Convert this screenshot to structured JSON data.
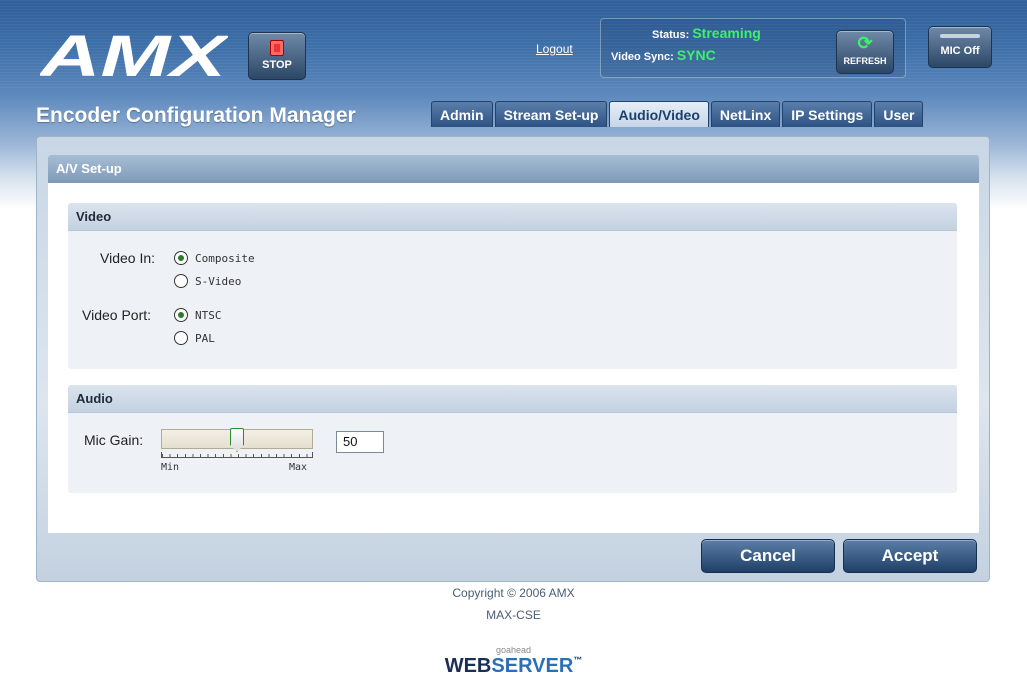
{
  "header": {
    "logo_text": "AMX",
    "stop_label": "STOP",
    "logout_label": "Logout",
    "status_label": "Status:",
    "status_value": "Streaming",
    "video_sync_label": "Video Sync:",
    "video_sync_value": "SYNC",
    "refresh_label": "REFRESH",
    "mic_label": "MIC Off",
    "app_title": "Encoder Configuration Manager"
  },
  "tabs": [
    {
      "label": "Admin"
    },
    {
      "label": "Stream Set-up"
    },
    {
      "label": "Audio/Video",
      "active": true
    },
    {
      "label": "NetLinx"
    },
    {
      "label": "IP Settings"
    },
    {
      "label": "User"
    }
  ],
  "panel": {
    "title": "A/V Set-up",
    "video": {
      "heading": "Video",
      "video_in_label": "Video In:",
      "video_in_options": [
        "Composite",
        "S-Video"
      ],
      "video_in_selected": "Composite",
      "video_port_label": "Video Port:",
      "video_port_options": [
        "NTSC",
        "PAL"
      ],
      "video_port_selected": "NTSC"
    },
    "audio": {
      "heading": "Audio",
      "mic_gain_label": "Mic Gain:",
      "mic_gain_value": "50",
      "slider_fraction": 0.5,
      "min_label": "Min",
      "max_label": "Max"
    }
  },
  "buttons": {
    "cancel": "Cancel",
    "accept": "Accept"
  },
  "footer": {
    "copyright": "Copyright © 2006 AMX",
    "model": "MAX-CSE",
    "server_small": "goahead",
    "server_web": "WEB",
    "server_big": "SERVER",
    "server_tm": "™"
  },
  "colors": {
    "status_green": "#3ef06b",
    "header_blue": "#2f5f9a"
  }
}
